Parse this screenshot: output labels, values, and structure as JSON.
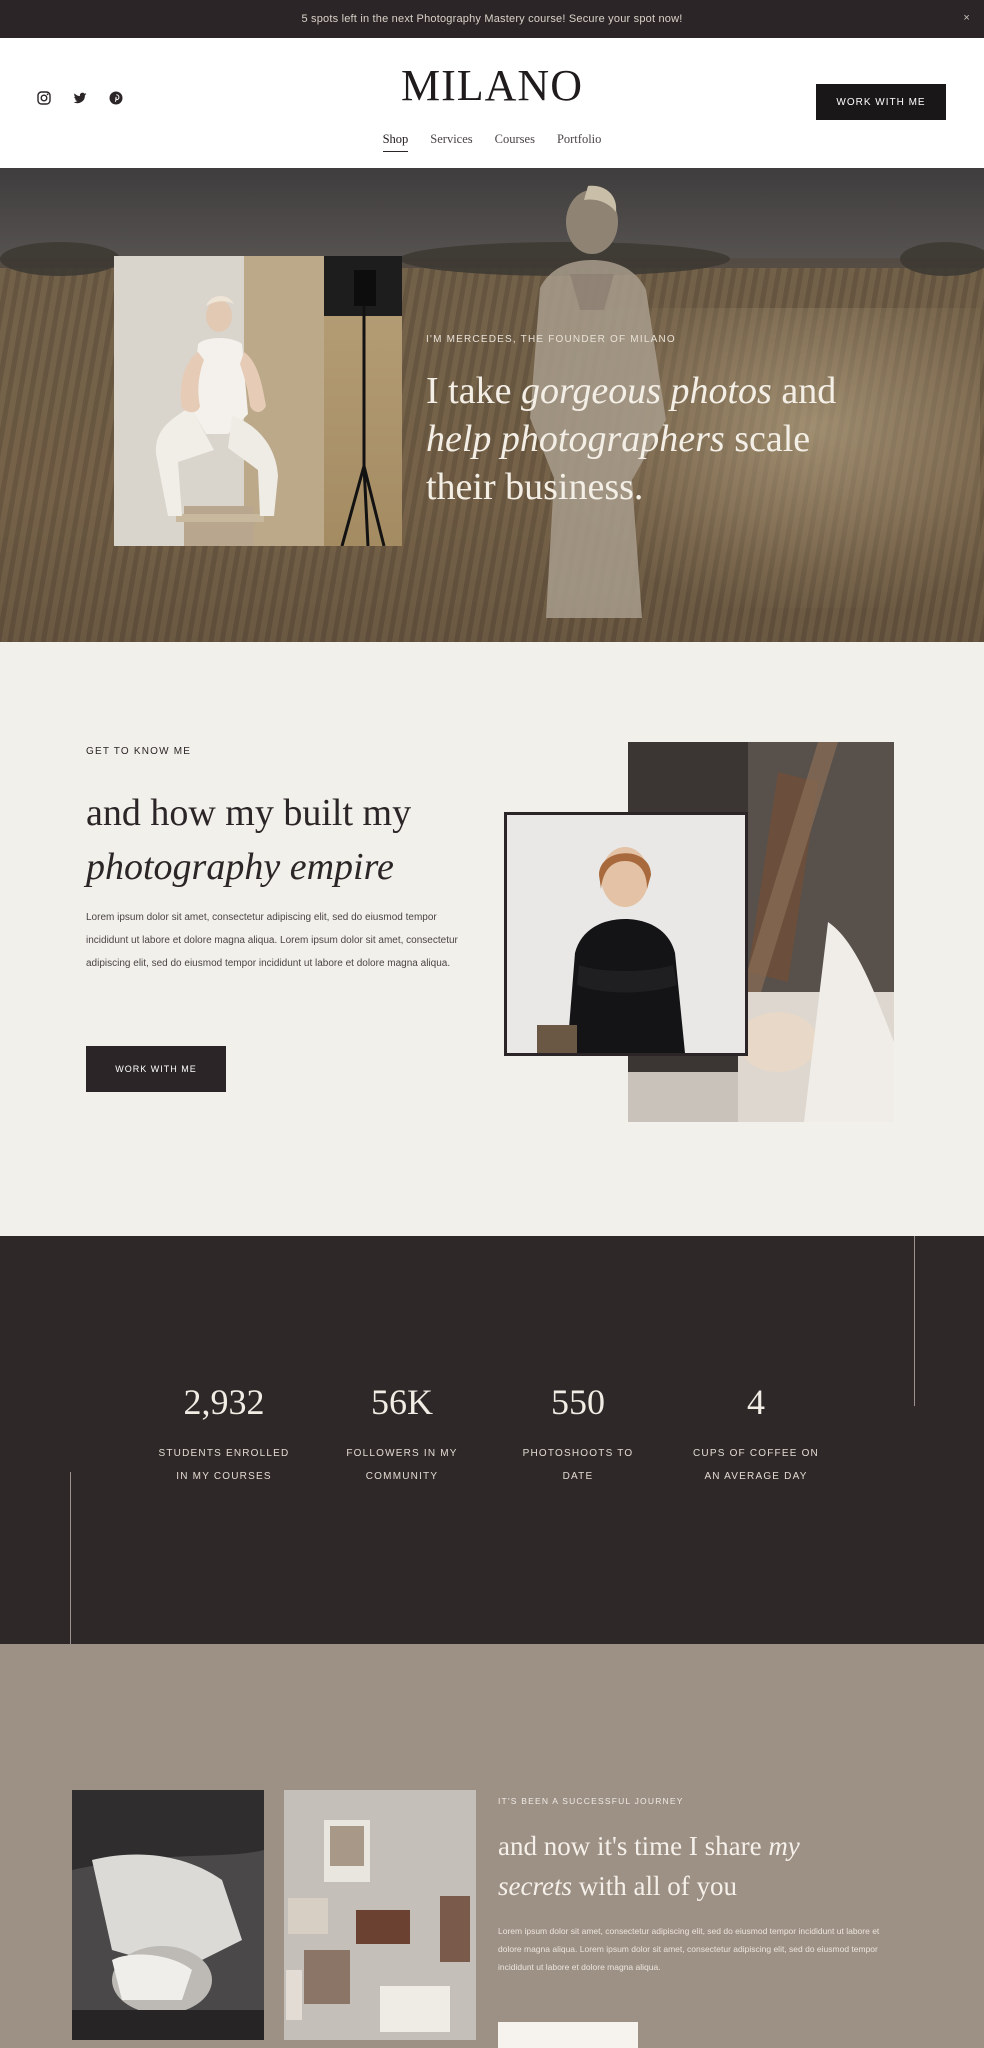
{
  "announcement": {
    "text": "5 spots left in the next Photography Mastery course! Secure your spot now!",
    "close": "×"
  },
  "header": {
    "logo": "MILANO",
    "nav": [
      "Shop",
      "Services",
      "Courses",
      "Portfolio"
    ],
    "cta": "WORK WITH ME",
    "social_icons": [
      "instagram-icon",
      "twitter-icon",
      "pinterest-icon"
    ]
  },
  "hero": {
    "eyebrow": "I'M MERCEDES, THE FOUNDER OF MILANO",
    "line1_a": "I take ",
    "line1_b": "gorgeous photos",
    "line1_c": " and",
    "line2_a": "help photographers",
    "line2_b": " scale",
    "line3": "their business."
  },
  "about": {
    "eyebrow": "GET TO KNOW ME",
    "heading_1": "and how my built my",
    "heading_2": "photography empire",
    "body": "Lorem ipsum dolor sit amet, consectetur adipiscing elit, sed do eiusmod tempor incididunt ut labore et dolore magna aliqua. Lorem ipsum dolor sit amet, consectetur adipiscing elit, sed do eiusmod tempor incididunt ut labore et dolore magna aliqua.",
    "cta": "WORK WITH ME"
  },
  "stats": [
    {
      "value": "2,932",
      "label_1": "STUDENTS ENROLLED",
      "label_2": "IN MY COURSES"
    },
    {
      "value": "56K",
      "label_1": "FOLLOWERS IN MY",
      "label_2": "COMMUNITY"
    },
    {
      "value": "550",
      "label_1": "PHOTOSHOOTS TO",
      "label_2": "DATE"
    },
    {
      "value": "4",
      "label_1": "CUPS OF COFFEE ON",
      "label_2": "AN AVERAGE DAY"
    }
  ],
  "journey": {
    "eyebrow": "IT'S BEEN A SUCCESSFUL JOURNEY",
    "heading_a": "and now it's time I share ",
    "heading_b": "my",
    "heading_c": "secrets",
    "heading_d": " with all of you",
    "body": "Lorem ipsum dolor sit amet, consectetur adipiscing elit, sed do eiusmod tempor incididunt ut labore et dolore magna aliqua. Lorem ipsum dolor sit amet, consectetur adipiscing elit, sed do eiusmod tempor incididunt ut labore et dolore magna aliqua."
  },
  "colors": {
    "dark": "#2b2527",
    "cream": "#f2f0ea",
    "taupe": "#9d9085"
  }
}
